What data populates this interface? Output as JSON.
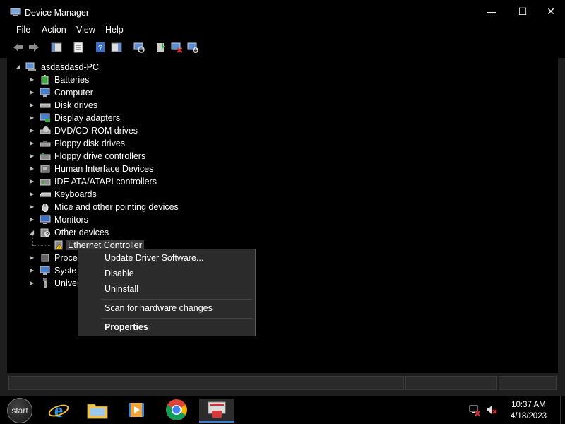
{
  "window": {
    "title": "Device Manager"
  },
  "window_controls": {
    "minimize": "—",
    "maximize": "☐",
    "close": "✕"
  },
  "menu": [
    "File",
    "Action",
    "View",
    "Help"
  ],
  "toolbar": {
    "buttons": [
      "back-icon",
      "forward-icon",
      "show-hide-console-tree-icon",
      "properties-icon",
      "help-icon",
      "action-pane-icon",
      "scan-hardware-icon",
      "update-driver-icon",
      "uninstall-icon",
      "enable-device-icon"
    ]
  },
  "tree": {
    "root": "asdasdasd-PC",
    "items": [
      {
        "label": "Batteries",
        "icon": "battery-icon"
      },
      {
        "label": "Computer",
        "icon": "computer-icon"
      },
      {
        "label": "Disk drives",
        "icon": "disk-drive-icon"
      },
      {
        "label": "Display adapters",
        "icon": "display-adapter-icon"
      },
      {
        "label": "DVD/CD-ROM drives",
        "icon": "dvd-drive-icon"
      },
      {
        "label": "Floppy disk drives",
        "icon": "floppy-drive-icon"
      },
      {
        "label": "Floppy drive controllers",
        "icon": "floppy-controller-icon"
      },
      {
        "label": "Human Interface Devices",
        "icon": "hid-icon"
      },
      {
        "label": "IDE ATA/ATAPI controllers",
        "icon": "ide-controller-icon"
      },
      {
        "label": "Keyboards",
        "icon": "keyboard-icon"
      },
      {
        "label": "Mice and other pointing devices",
        "icon": "mouse-icon"
      },
      {
        "label": "Monitors",
        "icon": "monitor-icon"
      },
      {
        "label": "Other devices",
        "icon": "unknown-device-icon",
        "expanded": true
      },
      {
        "label": "Ethernet Controller",
        "icon": "warning-device-icon",
        "child": true,
        "selected": true
      },
      {
        "label": "Proce",
        "icon": "processor-icon"
      },
      {
        "label": "Syste",
        "icon": "system-devices-icon"
      },
      {
        "label": "Univer",
        "icon": "usb-icon"
      }
    ]
  },
  "context_menu": {
    "update": "Update Driver Software...",
    "disable": "Disable",
    "uninstall": "Uninstall",
    "scan": "Scan for hardware changes",
    "properties": "Properties"
  },
  "taskbar": {
    "start_label": "start",
    "apps": [
      "internet-explorer-icon",
      "file-explorer-icon",
      "media-player-icon",
      "chrome-icon",
      "device-manager-icon"
    ],
    "time": "10:37 AM",
    "date": "4/18/2023"
  },
  "colors": {
    "accent": "#3c7cd6",
    "background": "#000000",
    "menu_bg": "#2b2b2b"
  }
}
